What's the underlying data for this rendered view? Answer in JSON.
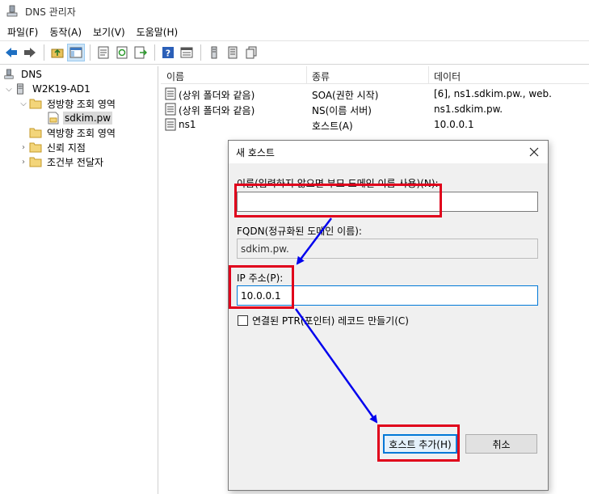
{
  "window": {
    "title": "DNS 관리자"
  },
  "menu": [
    "파일(F)",
    "동작(A)",
    "보기(V)",
    "도움말(H)"
  ],
  "tree": {
    "root": "DNS",
    "server": "W2K19-AD1",
    "forward_zones": "정방향 조회 영역",
    "zone": "sdkim.pw",
    "reverse_zones": "역방향 조회 영역",
    "trust_points": "신뢰 지점",
    "conditional_forwarders": "조건부 전달자"
  },
  "list": {
    "columns": [
      "이름",
      "종류",
      "데이터"
    ],
    "rows": [
      {
        "name": "(상위 폴더와 같음)",
        "type": "SOA(권한 시작)",
        "data": "[6], ns1.sdkim.pw., web."
      },
      {
        "name": "(상위 폴더와 같음)",
        "type": "NS(이름 서버)",
        "data": "ns1.sdkim.pw."
      },
      {
        "name": "ns1",
        "type": "호스트(A)",
        "data": "10.0.0.1"
      }
    ]
  },
  "dialog": {
    "title": "새 호스트",
    "name_label": "이름(입력하지 않으면 부모 도메인 이름 사용)(N):",
    "name_value": "",
    "fqdn_label": "FQDN(정규화된 도메인 이름):",
    "fqdn_value": "sdkim.pw.",
    "ip_label": "IP 주소(P):",
    "ip_value": "10.0.0.1",
    "ptr_label": "연결된 PTR(포인터) 레코드 만들기(C)",
    "ptr_checked": false,
    "add_button": "호스트 추가(H)",
    "cancel_button": "취소"
  },
  "colors": {
    "annotation_box": "#e0001b",
    "annotation_arrow": "#0000ee",
    "focus_blue": "#0078d7"
  },
  "icons": [
    "dns-icon",
    "back-icon",
    "forward-icon",
    "up-folder-icon",
    "console-tree-icon",
    "properties-icon",
    "refresh-icon",
    "export-icon",
    "help-icon",
    "view-icon",
    "server-icon",
    "list-icon",
    "copy-icon",
    "folder-icon",
    "zone-icon",
    "record-icon",
    "close-icon"
  ]
}
